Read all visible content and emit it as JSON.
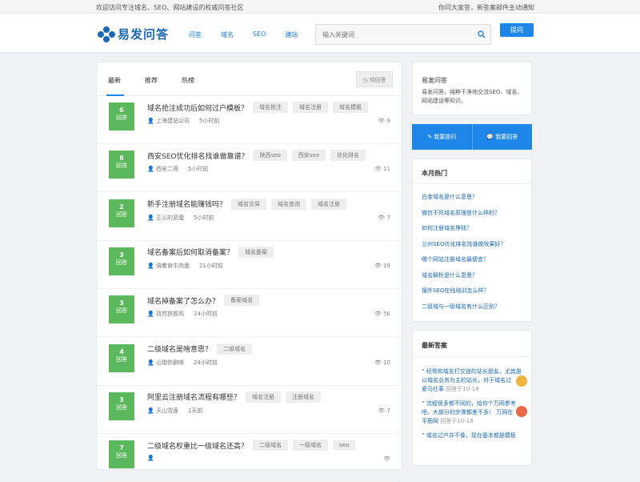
{
  "topbar": {
    "left": "欢迎访问专注域名、SEO、网站建设的权威问答社区",
    "right": "你问大家答，新答案邮件主动通知"
  },
  "logo": {
    "text": "易发问答"
  },
  "nav": [
    {
      "label": "问答"
    },
    {
      "label": "域名"
    },
    {
      "label": "SEO"
    },
    {
      "label": "建站"
    }
  ],
  "search": {
    "placeholder": "输入关键词"
  },
  "ask_button": "提问",
  "tabs": [
    {
      "label": "最新"
    },
    {
      "label": "推荐"
    },
    {
      "label": "热榜"
    }
  ],
  "pending_button": "待回答",
  "questions": [
    {
      "count": "6",
      "count_label": "回答",
      "title": "域名抢注成功后如何过户模板？",
      "tags": [
        "域名抢注",
        "域名注册",
        "域名模板"
      ],
      "user": "上海建站公司",
      "time": "5小时前",
      "views": "9"
    },
    {
      "count": "8",
      "count_label": "回答",
      "title": "西安SEO优化排名找谁做靠谱？",
      "tags": [
        "陕西seo",
        "西安seo",
        "优化排名"
      ],
      "user": "西安二哥",
      "time": "5小时前",
      "views": "11"
    },
    {
      "count": "2",
      "count_label": "回答",
      "title": "新手注册域名能赚钱吗？",
      "tags": [
        "域名交易",
        "域名查询",
        "域名注册"
      ],
      "user": "正义的恶魔",
      "time": "5小时前",
      "views": "7"
    },
    {
      "count": "3",
      "count_label": "回答",
      "title": "域名备案后如何取消备案？",
      "tags": [
        "域名备案"
      ],
      "user": "骑着肯牛肉面",
      "time": "21小时前",
      "views": "19"
    },
    {
      "count": "3",
      "count_label": "回答",
      "title": "域名掉备案了怎么办？",
      "tags": [
        "备案域名"
      ],
      "user": "孜然铁板鸡",
      "time": "24小时前",
      "views": "56"
    },
    {
      "count": "4",
      "count_label": "回答",
      "title": "二级域名是啥意思？",
      "tags": [
        "二级域名"
      ],
      "user": "山炮你删啥",
      "time": "24小时前",
      "views": "10"
    },
    {
      "count": "3",
      "count_label": "回答",
      "title": "阿里云注册域名流程有哪些？",
      "tags": [
        "域名注册",
        "注册域名"
      ],
      "user": "天山雪莲",
      "time": "1天前",
      "views": "7"
    },
    {
      "count": "7",
      "count_label": "回答",
      "title": "二级域名权重比一级域名还高？",
      "tags": [
        "二级域名",
        "一级域名",
        "seo"
      ],
      "user": "",
      "time": "",
      "views": ""
    }
  ],
  "about": {
    "title": "易发问答",
    "desc": "易发问答，纯粹干净地交流SEO、域名、网站建设等知识。"
  },
  "side_buttons": [
    {
      "label": "我要提问"
    },
    {
      "label": "我要回答"
    }
  ],
  "hot": {
    "title": "本月热门",
    "items": [
      "白金域名是什么意思？",
      "微信不死域名原理是什么样的？",
      "如何注册域名挣钱？",
      "兰州SEO优化排名找谁做效果好？",
      "哪个网站注册域名最便宜？",
      "域名解析是什么意思？",
      "搜外SEO在线培训怎么样？",
      "二级域与一级域名有什么区别？"
    ]
  },
  "latest_answers": {
    "title": "最新答案",
    "items": [
      {
        "text": "“ 经常和域名打交道的站长朋友，尤其是以域名业务为主的站长，对于域名过",
        "user": "爱马仕革",
        "time": "回答于10-18"
      },
      {
        "text": "“ 流程很多都不同的，给你个万网参考吧，大部分的步骤都差不多！ 万网在",
        "user": "平筋网",
        "time": "回答于10-18"
      },
      {
        "text": "“ 域名过户并不像，现在基本都是模板",
        "user": "",
        "time": ""
      }
    ]
  },
  "colors": {
    "accent": "#1e86e6",
    "badge": "#5cb85c",
    "link": "#1a67b5"
  }
}
